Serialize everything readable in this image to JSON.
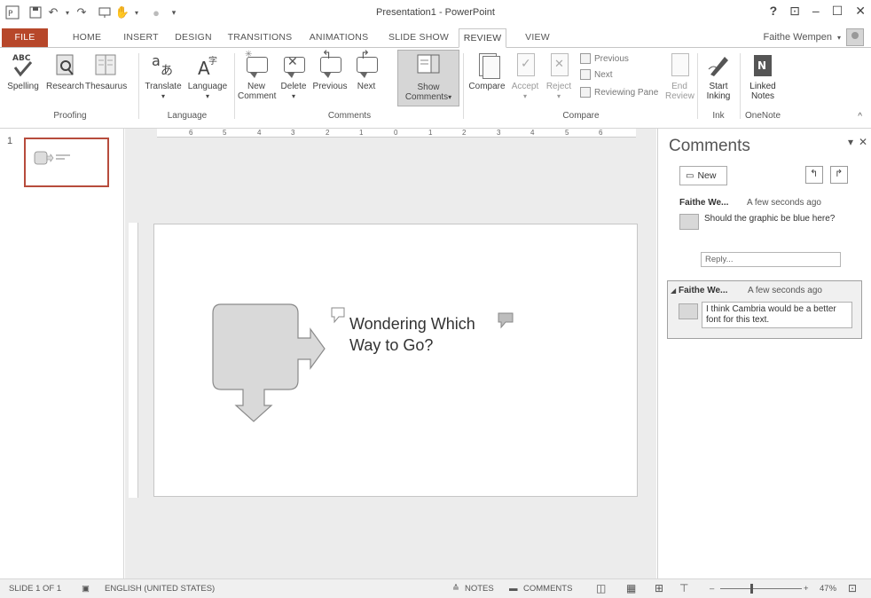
{
  "window": {
    "title": "Presentation1 - PowerPoint"
  },
  "tabs": [
    "FILE",
    "HOME",
    "INSERT",
    "DESIGN",
    "TRANSITIONS",
    "ANIMATIONS",
    "SLIDE SHOW",
    "REVIEW",
    "VIEW"
  ],
  "account": {
    "name": "Faithe Wempen"
  },
  "ribbon": {
    "proofing": {
      "spelling": "Spelling",
      "research": "Research",
      "thesaurus": "Thesaurus",
      "label": "Proofing"
    },
    "language": {
      "translate": "Translate",
      "language": "Language",
      "label": "Language"
    },
    "comments": {
      "new_comment_1": "New",
      "new_comment_2": "Comment",
      "delete": "Delete",
      "previous": "Previous",
      "next": "Next",
      "show_comments_1": "Show",
      "show_comments_2": "Comments",
      "label": "Comments"
    },
    "compare": {
      "compare": "Compare",
      "accept": "Accept",
      "reject": "Reject",
      "previous": "Previous",
      "next": "Next",
      "reviewing_pane": "Reviewing Pane",
      "end_review_1": "End",
      "end_review_2": "Review",
      "label": "Compare"
    },
    "ink": {
      "start_1": "Start",
      "start_2": "Inking",
      "label": "Ink"
    },
    "onenote": {
      "linked_1": "Linked",
      "linked_2": "Notes",
      "label": "OneNote"
    }
  },
  "thumbnails": {
    "slide_number": "1"
  },
  "ruler": {
    "labels": [
      "6",
      "5",
      "4",
      "3",
      "2",
      "1",
      "0",
      "1",
      "2",
      "3",
      "4",
      "5",
      "6"
    ]
  },
  "slide": {
    "title_line1": "Wondering Which",
    "title_line2": "Way to Go?"
  },
  "comments_pane": {
    "title": "Comments",
    "new_label": "New",
    "comments": [
      {
        "author": "Faithe We...",
        "time": "A few seconds ago",
        "text": "Should the graphic be blue here?"
      },
      {
        "author": "Faithe We...",
        "time": "A few seconds ago",
        "text": "I think Cambria would be a better font for this text."
      }
    ],
    "reply_placeholder": "Reply..."
  },
  "status": {
    "slide": "SLIDE 1 OF 1",
    "language": "ENGLISH (UNITED STATES)",
    "notes": "NOTES",
    "comments": "COMMENTS",
    "zoom": "47%"
  }
}
